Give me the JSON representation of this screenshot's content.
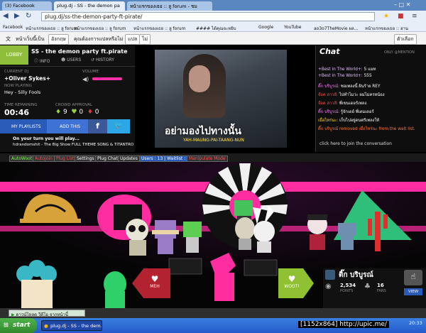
{
  "browser": {
    "tabs": [
      "(3) Facebook",
      "plug.dj - SS - the demon pa",
      "หน้าแรกของเธอ :: ลู forum - ชม"
    ],
    "url": "plug.dj/ss-the-demon-party-ft-pirate/",
    "bookmarks": [
      "Facebook",
      "หน้าแรกของเธอ :: ลู forum",
      "หน้าแรกของเธอ :: ลู forum",
      "หน้าแรกของเธอ :: ลู forum",
      "#### ได้คุณจะหยิบ",
      "Google",
      "YouTube",
      "ao3o7TheMovie ผล...",
      "หน้าแรกของเธอ :: อาน"
    ],
    "translate": {
      "prefix": "หน้าเว็บนี้เป็น",
      "language": "อังกฤษ",
      "question": "คุณต้องการแปลหรือไม่",
      "translate_btn": "แปล",
      "no_btn": "ไม่",
      "options_btn": "ตัวเลือก"
    }
  },
  "room": {
    "lobby": "LOBBY",
    "name": "SS - the demon party ft.pirate",
    "tabs": [
      "INFO",
      "USERS",
      "HISTORY"
    ],
    "current_dj_label": "CURRENT DJ",
    "current_dj": "+Oliver Sykes+",
    "now_playing_label": "NOW PLAYING",
    "now_playing": "Hey - Silly Fools",
    "volume_label": "VOLUME",
    "time_label": "TIME REMAINING",
    "time": "00:46",
    "crowd_label": "CROWD APPROVAL",
    "woots": "9",
    "grabs": "0",
    "mehs": "0",
    "my_playlists": "MY PLAYLISTS",
    "add_this": "ADD THIS",
    "next_label": "On your turn you will play...",
    "next_song": "hdrandomshit - The Big Show FULL THEME SONG & TITANTRO!"
  },
  "video": {
    "subtitle_thai": "อย่ามองไปทางนั้น",
    "subtitle_roman": "YAH-MAUNG-PAI-TAANG-NUN"
  },
  "chat": {
    "title": "Chat",
    "meta": "ONLY @MENTION",
    "messages": [
      {
        "user": "+Best in The World+:",
        "text": "5 แมท",
        "color": "#e6b7ff"
      },
      {
        "user": "+Best in The World+:",
        "text": "555",
        "color": "#e6b7ff"
      },
      {
        "user": "ติ๊ก บริบูรณ์:",
        "text": "ซอเพลงนี้ ฝันร้าย REY",
        "color": "#ff7aff"
      },
      {
        "user": "จ๊อต สาวลี:",
        "text": "ไปทำไมว่ะ ผมไม่ครหน้อง",
        "color": "#ff4f4f"
      },
      {
        "user": "จ๊อต สาวลี:",
        "text": "พี่เขนเดอร์เพลง",
        "color": "#ff4f4f"
      },
      {
        "user": "ติ๊ก บริบูรณ์:",
        "text": "รู้จักเดย์ พี่เดมเดอร์",
        "color": "#ff7aff"
      },
      {
        "user": "เมื่อไหร่นะ:",
        "text": "เก็บไปอยู่ดนตรีเพลงให้",
        "color": "#ffd23f"
      },
      {
        "user": "ติ๊ก บริบูรณ์",
        "text": "removed เมื่อไหร่นะ from the wait list.",
        "color": "#ff7a3a"
      }
    ],
    "input_placeholder": "click here to join the conversation"
  },
  "toolbar": {
    "items": [
      "AutoWoot",
      "AutoJoin",
      "Plug List",
      "Settings",
      "Plug Chat",
      "Updates",
      "Users : 13 | Waitlist : 4",
      "Manipulate Mode"
    ]
  },
  "stage": {
    "meh": "MEH",
    "woot": "WOOT!",
    "dj_name": "ติ๊ก บริบูรณ์",
    "points": "2,534",
    "points_label": "POINTS",
    "fans": "16",
    "fans_label": "FANS",
    "view": "VIEW"
  },
  "downloadbar": {
    "label": "ดาวน์โหลด วีดีโอ จากหน้านี้"
  },
  "taskbar": {
    "start": "start",
    "item1": "plug.dj - SS - the dem...",
    "lang": "TH",
    "time": "20:33"
  },
  "watermark": "[1152x864] http://upic.me/"
}
